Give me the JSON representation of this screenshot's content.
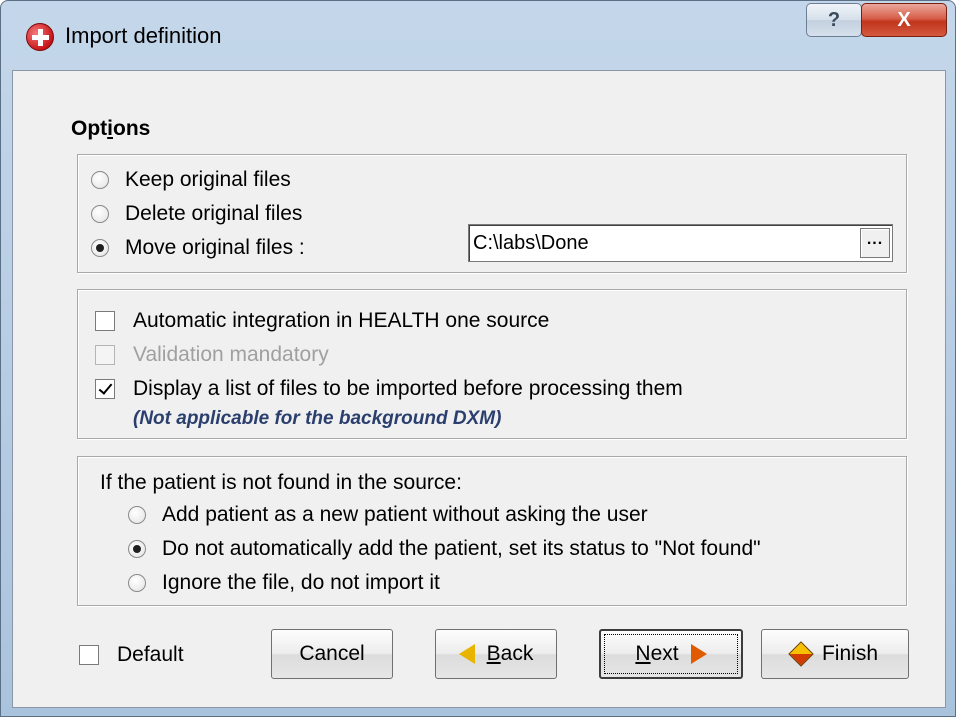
{
  "window": {
    "title": "Import definition",
    "help_glyph": "?",
    "close_glyph": "X",
    "icon": "red-cross-icon"
  },
  "options": {
    "section_title": "Options",
    "file_handling": [
      {
        "label": "Keep original files",
        "selected": false
      },
      {
        "label": "Delete original files",
        "selected": false
      },
      {
        "label": "Move original files :",
        "selected": true
      }
    ],
    "move_path": "C:\\labs\\Done",
    "browse_label": "...",
    "integration": {
      "automatic_label": "Automatic integration in HEALTH one source",
      "automatic_checked": false,
      "validation_label": "Validation mandatory",
      "validation_checked": false,
      "validation_enabled": false,
      "display_list_label": "Display a list of files to be imported before processing them",
      "display_list_checked": true,
      "display_list_note": "(Not applicable for the background DXM)"
    },
    "patient_not_found": {
      "prompt": "If the patient is not found in the source:",
      "choices": [
        {
          "label": "Add patient as a new patient without asking the user",
          "selected": false
        },
        {
          "label": "Do not automatically add the patient, set its status to \"Not found\"",
          "selected": true
        },
        {
          "label": "Ignore the file, do not import it",
          "selected": false
        }
      ]
    }
  },
  "footer": {
    "default_label": "Default",
    "default_checked": false,
    "cancel_label": "Cancel",
    "back_label": "Back",
    "next_label": "Next",
    "finish_label": "Finish"
  },
  "colors": {
    "titlebar": "#b9cfe6",
    "client_bg": "#f0f0f0",
    "close_button": "#c7432a",
    "note_text": "#2b3f6e"
  }
}
